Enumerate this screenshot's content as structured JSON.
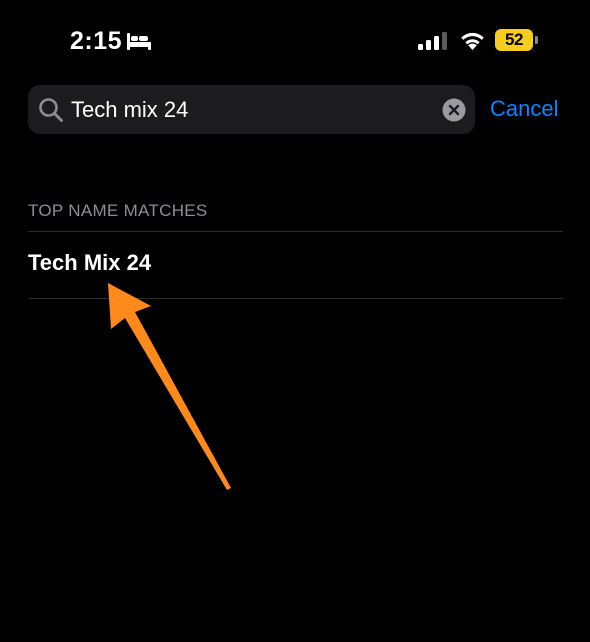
{
  "status_bar": {
    "time": "2:15",
    "battery_level": "52",
    "icons": [
      "bed-icon",
      "signal-icon",
      "wifi-icon",
      "battery-icon"
    ]
  },
  "search": {
    "query": "Tech mix 24",
    "cancel_label": "Cancel",
    "icons": [
      "search-icon",
      "clear-icon"
    ]
  },
  "results": {
    "section_header": "TOP NAME MATCHES",
    "items": [
      {
        "label": "Tech Mix 24"
      }
    ]
  },
  "annotation": {
    "arrow_color": "#ff8a1c"
  },
  "colors": {
    "background": "#000000",
    "accent": "#0a84ff",
    "search_field": "#1c1c1e",
    "secondary_text": "#8d8d93",
    "battery": "#f7ce1e"
  }
}
